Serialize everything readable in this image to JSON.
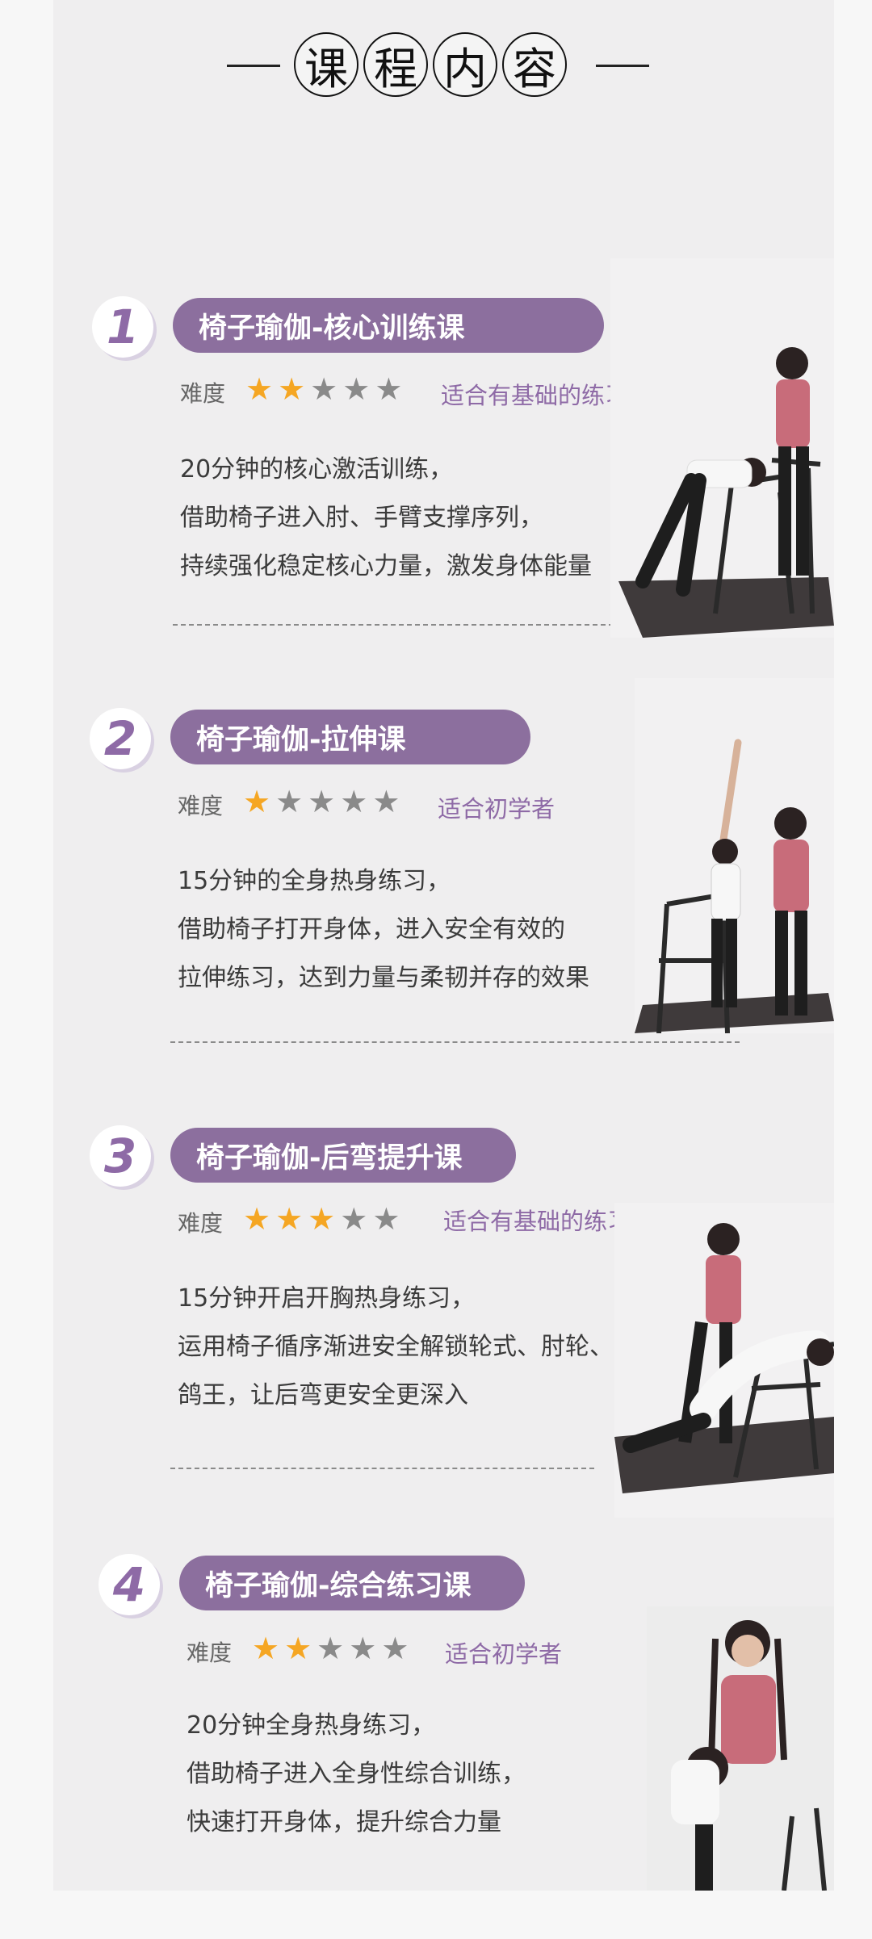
{
  "header": {
    "title_chars": [
      "课",
      "程",
      "内",
      "容"
    ]
  },
  "difficulty_label": "难度",
  "courses": [
    {
      "number": "1",
      "title": "椅子瑜伽-核心训练课",
      "rating": 2,
      "level": "适合有基础的练习",
      "lines": [
        "20分钟的核心激活训练，",
        "借助椅子进入肘、手臂支撑序列，",
        "持续强化稳定核心力量，激发身体能量"
      ]
    },
    {
      "number": "2",
      "title": "椅子瑜伽-拉伸课",
      "rating": 1,
      "level": "适合初学者",
      "lines": [
        "15分钟的全身热身练习，",
        "借助椅子打开身体，进入安全有效的",
        "拉伸练习，达到力量与柔韧并存的效果"
      ]
    },
    {
      "number": "3",
      "title": "椅子瑜伽-后弯提升课",
      "rating": 3,
      "level": "适合有基础的练习",
      "lines": [
        "15分钟开启开胸热身练习，",
        "运用椅子循序渐进安全解锁轮式、肘轮、",
        "鸽王，让后弯更安全更深入"
      ]
    },
    {
      "number": "4",
      "title": "椅子瑜伽-综合练习课",
      "rating": 2,
      "level": "适合初学者",
      "lines": [
        "20分钟全身热身练习，",
        "借助椅子进入全身性综合训练，",
        "快速打开身体，提升综合力量"
      ]
    }
  ],
  "colors": {
    "accent": "#8c6f9e",
    "star_on": "#f5a623",
    "star_off": "#8a8a8a",
    "panel": "#efeeef"
  }
}
